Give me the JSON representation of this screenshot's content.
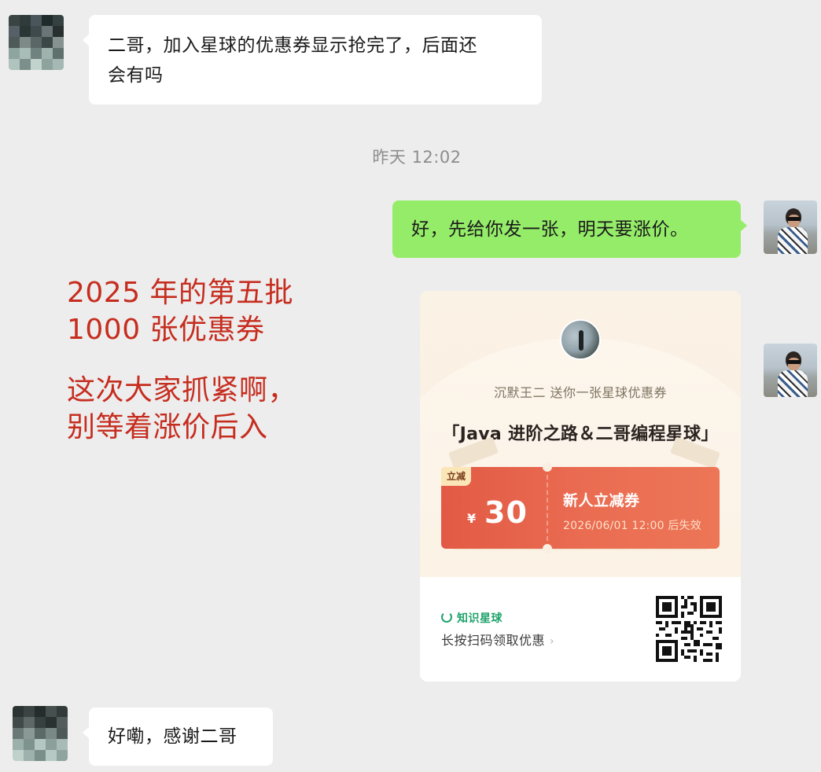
{
  "chat": {
    "msg1": {
      "line1": "二哥，加入星球的优惠券显示抢完了，后面还",
      "line2": "会有吗"
    },
    "timestamp": "昨天 12:02",
    "msg2": "好，先给你发一张，明天要涨价。",
    "msg4": "好嘞，感谢二哥"
  },
  "coupon_card": {
    "sender": "沉默王二 送你一张星球优惠券",
    "title": "「Java 进阶之路＆二哥编程星球」",
    "tag": "立减",
    "currency": "¥",
    "amount": "30",
    "name": "新人立减券",
    "expire": "2026/06/01 12:00 后失效",
    "brand": "知识星球",
    "hint": "长按扫码领取优惠",
    "chevron": "›"
  },
  "annotation": {
    "line1": "2025 年的第五批",
    "line2": "1000 张优惠券",
    "line3": "这次大家抓紧啊，",
    "line4": "别等着涨价后入"
  },
  "colors": {
    "background": "#ededed",
    "right_bubble": "#95ec69",
    "annotation": "#c62d1f",
    "coupon": "#e25a45",
    "brand": "#1fa36b"
  }
}
